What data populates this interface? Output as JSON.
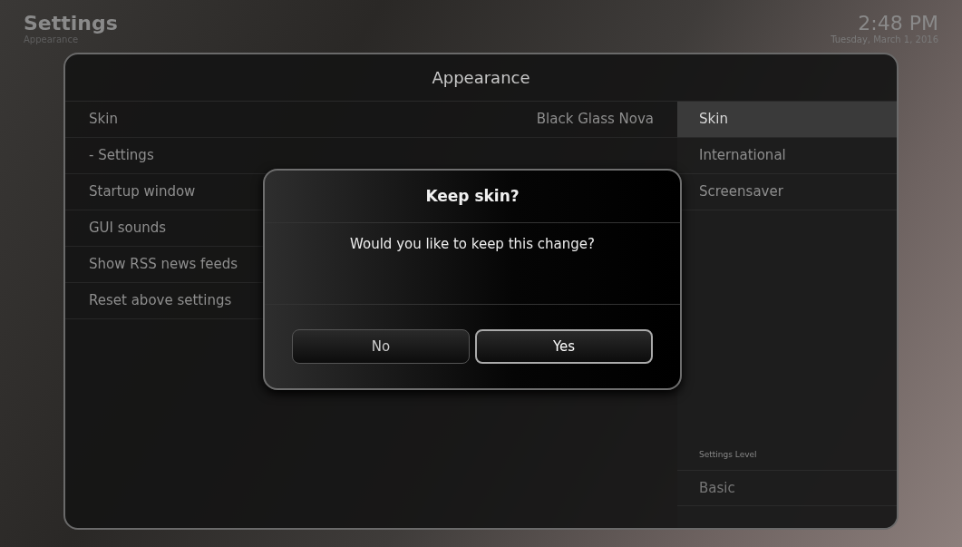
{
  "header": {
    "title": "Settings",
    "subtitle": "Appearance",
    "time": "2:48 PM",
    "date": "Tuesday, March 1, 2016"
  },
  "panel": {
    "title": "Appearance",
    "settings": [
      {
        "label": "Skin",
        "value": "Black Glass Nova"
      },
      {
        "label": "- Settings"
      },
      {
        "label": "Startup window"
      },
      {
        "label": "GUI sounds"
      },
      {
        "label": "Show RSS news feeds"
      },
      {
        "label": "Reset above settings"
      }
    ],
    "categories": [
      {
        "label": "Skin",
        "selected": true
      },
      {
        "label": "International",
        "selected": false
      },
      {
        "label": "Screensaver",
        "selected": false
      }
    ],
    "settings_level": {
      "label": "Settings Level",
      "value": "Basic"
    }
  },
  "dialog": {
    "title": "Keep skin?",
    "message": "Would you like to keep this change?",
    "buttons": [
      {
        "label": "No",
        "selected": false
      },
      {
        "label": "Yes",
        "selected": true
      }
    ]
  }
}
